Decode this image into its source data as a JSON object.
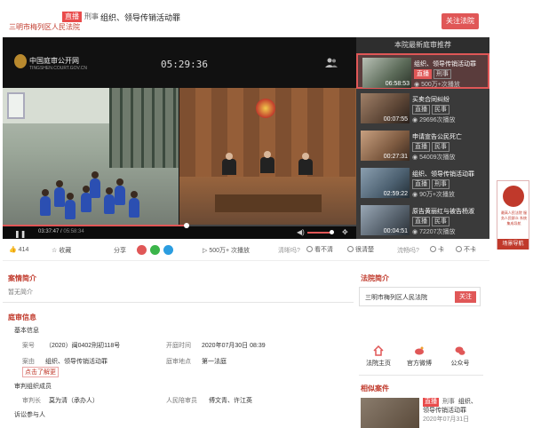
{
  "header": {
    "live_tag": "直播",
    "case_type": "刑事",
    "title": "组织、领导传销活动罪",
    "court": "三明市梅列区人民法院",
    "follow_btn": "关注法院"
  },
  "player": {
    "logo_text": "中国庭审公开网",
    "logo_sub": "TINGSHEN.COURT.GOV.CN",
    "timecode": "05:29:36",
    "current_time": "03:37:47",
    "total_time": "05:58:34",
    "progress": 0.52,
    "volume": 0.85
  },
  "recommend": {
    "title": "本院最新庭审推荐",
    "items": [
      {
        "name": "组织、领导传销活动罪",
        "tags": [
          "直播",
          "刑事"
        ],
        "live": true,
        "duration": "06:58:53",
        "views": "500万+次播放",
        "active": true
      },
      {
        "name": "买卖合同纠纷",
        "tags": [
          "直播",
          "民事"
        ],
        "live": false,
        "duration": "00:07:55",
        "views": "29696次播放",
        "active": false
      },
      {
        "name": "申请宣告公民死亡",
        "tags": [
          "直播",
          "民事"
        ],
        "live": false,
        "duration": "00:27:31",
        "views": "54009次播放",
        "active": false
      },
      {
        "name": "组织、领导传销活动罪",
        "tags": [
          "直播",
          "刑事"
        ],
        "live": false,
        "duration": "02:59:22",
        "views": "90万+次播放",
        "active": false
      },
      {
        "name": "原告黄丽红与被告杨淑",
        "tags": [
          "直播",
          "民事"
        ],
        "live": false,
        "duration": "00:04:51",
        "views": "72207次播放",
        "active": false
      }
    ]
  },
  "floating": {
    "text": "最高人民法院 服务人民群众 系统集成导航",
    "button": "场景导航"
  },
  "actions": {
    "likes": "414",
    "collect": "收藏",
    "share": "分享",
    "plays": "500万+ 次播放",
    "clarity_label": "清晰吗?",
    "clarity_opt1": "看不清",
    "clarity_opt2": "很清楚",
    "smooth_label": "流畅吗?",
    "smooth_opt1": "卡",
    "smooth_opt2": "不卡"
  },
  "case_intro": {
    "title": "案情简介",
    "content": "暂无简介"
  },
  "trial_info": {
    "title": "庭审信息",
    "basic_label": "基本信息",
    "case_no_label": "案号",
    "case_no": "（2020）闽0402刑初118号",
    "open_time_label": "开庭时间",
    "open_time": "2020年07月30日 08:39",
    "cause_label": "案由",
    "cause": "组织、领导传销活动罪",
    "learn_more": "点击了解更",
    "location_label": "庭审地点",
    "location": "第一法庭",
    "panel_label": "审判组织成员",
    "chief_label": "审判长",
    "chief": "莫为清（承办人）",
    "juror_label": "人民陪审员",
    "jurors": "傅文青、许江英",
    "parties_label": "诉讼参与人"
  },
  "court_intro": {
    "title": "法院简介",
    "name": "三明市梅列区人民法院",
    "follow": "关注",
    "links": [
      "法院主页",
      "官方微博",
      "公众号"
    ]
  },
  "related": {
    "title": "相似案件",
    "tags": [
      "直播",
      "刑事"
    ],
    "name_tail": "组织、",
    "name_line2": "领导传销活动罪",
    "date": "2020年07月31日"
  }
}
